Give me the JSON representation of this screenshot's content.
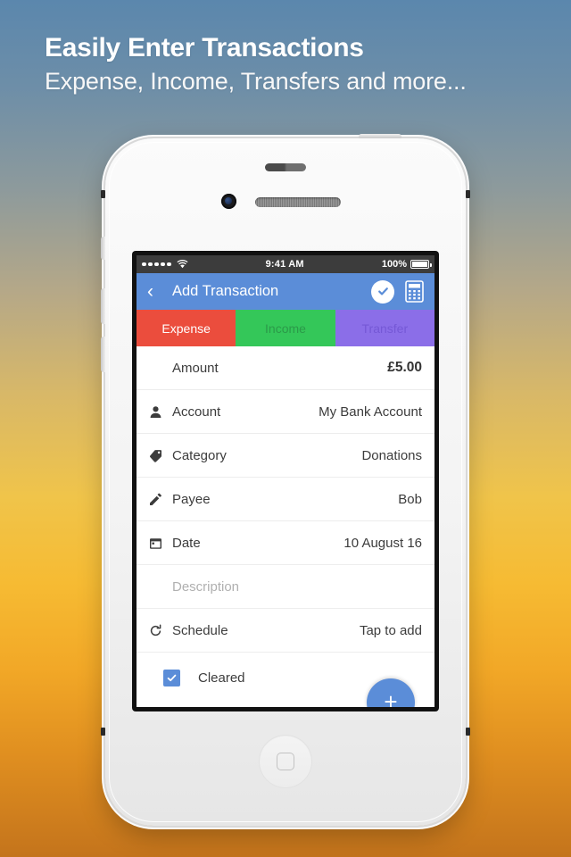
{
  "promo": {
    "headline": "Easily Enter Transactions",
    "subheadline": "Expense, Income, Transfers and more...",
    "background_top_color": "#5b87ad",
    "background_bottom_color": "#c4741c"
  },
  "status_bar": {
    "signal_dots": 5,
    "wifi_icon": "wifi-icon",
    "time": "9:41 AM",
    "battery_percent": "100%"
  },
  "nav_bar": {
    "back_icon": "chevron-left-icon",
    "title": "Add Transaction",
    "confirm_icon": "check-circle-icon",
    "calculator_icon": "calculator-icon",
    "color": "#5b8dd8"
  },
  "tabs": [
    {
      "label": "Expense",
      "color": "#eb4d3d",
      "selected": true
    },
    {
      "label": "Income",
      "color": "#34c759",
      "selected": false
    },
    {
      "label": "Transfer",
      "color": "#8b6ee8",
      "selected": false
    }
  ],
  "form_rows": [
    {
      "icon": "",
      "label": "Amount",
      "value": "£5.00"
    },
    {
      "icon": "person-icon",
      "label": "Account",
      "value": "My Bank Account"
    },
    {
      "icon": "tag-icon",
      "label": "Category",
      "value": "Donations"
    },
    {
      "icon": "pencil-icon",
      "label": "Payee",
      "value": "Bob"
    },
    {
      "icon": "calendar-icon",
      "label": "Date",
      "value": "10 August 16"
    },
    {
      "icon": "",
      "label": "Description",
      "value": ""
    },
    {
      "icon": "refresh-icon",
      "label": "Schedule",
      "value": "Tap to add"
    }
  ],
  "description_placeholder": "Description",
  "cleared": {
    "label": "Cleared",
    "checked": true,
    "color": "#5b8dd8"
  },
  "fab": {
    "icon": "plus-icon",
    "color": "#5b8dd8"
  }
}
